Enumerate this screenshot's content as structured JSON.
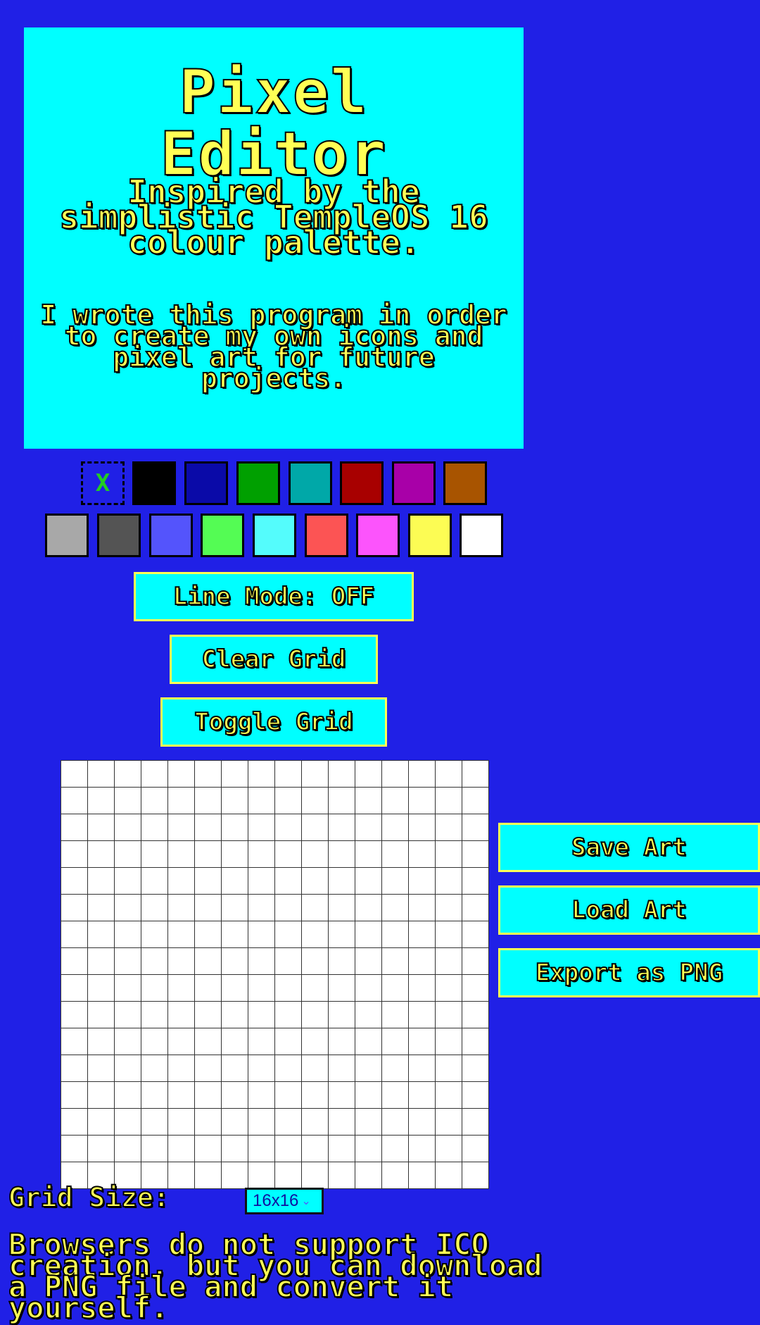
{
  "intro": {
    "title_line1": "Pixel",
    "title_line2": "Editor",
    "tagline": "Inspired by the simplistic TempleOS 16 colour palette.",
    "description": "I wrote this program in order to create my own icons and pixel art for future projects."
  },
  "palette": {
    "transparent_label": "X",
    "colors": [
      "#000000",
      "#0a0aa8",
      "#00a000",
      "#00a8a8",
      "#a80000",
      "#a800a8",
      "#a85400",
      "#a8a8a8",
      "#545454",
      "#5454fc",
      "#54fc54",
      "#54fcfc",
      "#fc5454",
      "#fc54fc",
      "#fcfc54",
      "#ffffff"
    ]
  },
  "buttons": {
    "line_mode": "Line Mode: OFF",
    "clear_grid": "Clear Grid",
    "toggle_grid": "Toggle Grid",
    "save_art": "Save Art",
    "load_art": "Load Art",
    "export_png": "Export as PNG"
  },
  "grid": {
    "rows": 16,
    "cols": 16
  },
  "grid_size": {
    "label": "Grid Size:",
    "selected": "16x16"
  },
  "ico_note": "Browsers do not support ICO creation, but you can download a PNG file and convert it yourself."
}
